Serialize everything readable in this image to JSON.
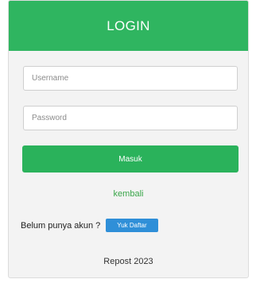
{
  "header": {
    "title": "LOGIN"
  },
  "form": {
    "username_placeholder": "Username",
    "password_placeholder": "Password",
    "submit_label": "Masuk"
  },
  "links": {
    "back_label": "kembali"
  },
  "signup": {
    "prompt": "Belum punya akun ?",
    "button_label": "Yuk Daftar"
  },
  "footer": {
    "text": "Repost 2023"
  },
  "colors": {
    "header_bg": "#2fb560",
    "primary_button": "#2ab25b",
    "signup_button": "#2f8fd8",
    "link": "#3aa64a"
  }
}
